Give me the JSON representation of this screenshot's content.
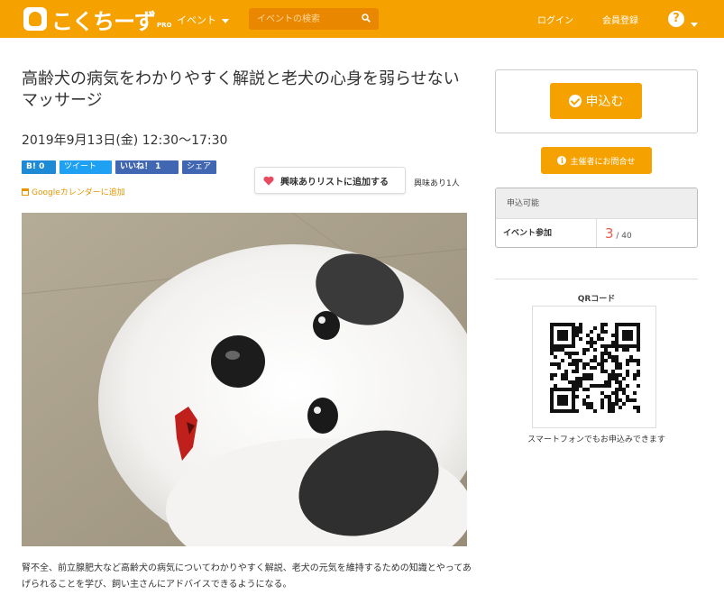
{
  "header": {
    "logo_text": "こくちーず",
    "logo_sub": "PRO",
    "nav_event": "イベント",
    "search_placeholder": "イベントの検索",
    "login": "ログイン",
    "register": "会員登録",
    "help": "?"
  },
  "event": {
    "title": "高齢犬の病気をわかりやすく解説と老犬の心身を弱らせないマッサージ",
    "date": "2019年9月13日(金) 12:30〜17:30",
    "share": {
      "hatena": "B! 0",
      "tweet": "ツイート",
      "like": "いいね！ 1",
      "fbshare": "シェア"
    },
    "gcal": "Googleカレンダーに追加",
    "fav_button": "興味ありリストに追加する",
    "fav_count": "興味あり1人",
    "description": "腎不全、前立腺肥大など高齢犬の病気についてわかりやすく解説、老犬の元気を維持するための知識とやってあげられることを学び、飼い主さんにアドバイスできるようになる。"
  },
  "sidebar": {
    "apply": "申込む",
    "contact": "主催者にお問合せ",
    "status_head": "申込可能",
    "status_label": "イベント参加",
    "status_current": "3",
    "status_cap": " / 40",
    "qr_label": "QRコード",
    "qr_caption": "スマートフォンでもお申込みできます"
  },
  "colors": {
    "brand": "#f5a200",
    "accent_red": "#e85b4a"
  }
}
